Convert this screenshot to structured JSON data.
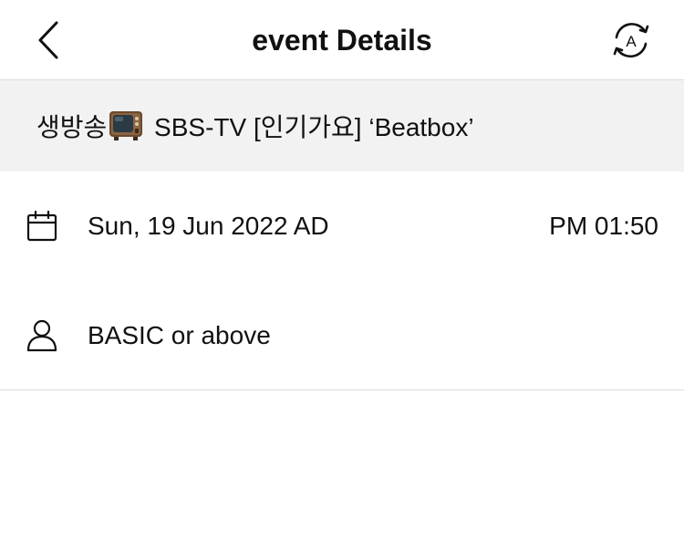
{
  "nav": {
    "title": "event Details",
    "back_icon": "chevron-left-icon",
    "translate_icon": "translate-refresh-icon",
    "translate_letter": "A"
  },
  "event": {
    "title_prefix": "생방송",
    "title_icon": "television-icon",
    "title_suffix": " SBS-TV [인기가요] ‘Beatbox’"
  },
  "details": {
    "date": "Sun, 19 Jun 2022 AD",
    "time": "PM 01:50",
    "date_icon": "calendar-icon",
    "grade": "BASIC or above",
    "grade_icon": "person-icon"
  },
  "colors": {
    "banner_background": "#f2f2f2",
    "divider": "#dcdcdc",
    "text": "#111111"
  }
}
